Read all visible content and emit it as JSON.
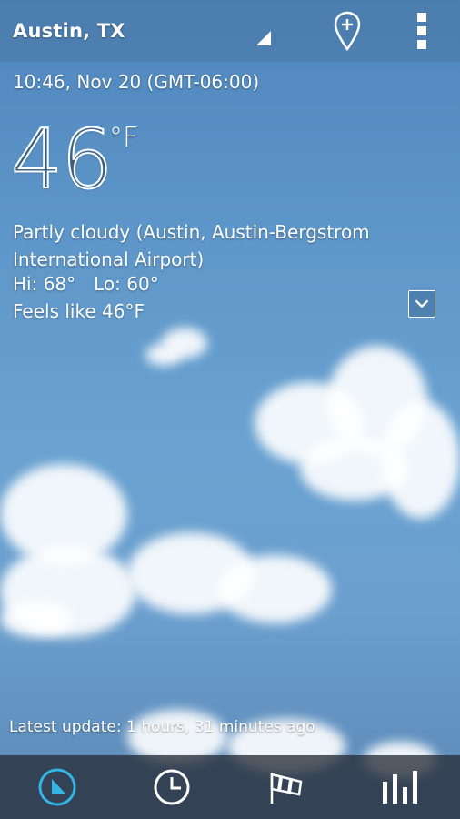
{
  "header": {
    "location": "Austin, TX"
  },
  "weather": {
    "datetime": "10:46, Nov 20 (GMT-06:00)",
    "temperature": "46",
    "unit": "°F",
    "condition": "Partly cloudy (Austin, Austin-Bergstrom International Airport)",
    "hi": "Hi: 68°",
    "lo": "Lo: 60°",
    "feels_like": "Feels like 46°F"
  },
  "footer": {
    "latest_update": "Latest update: 1 hours, 31 minutes ago"
  },
  "tabs": [
    {
      "name": "current-tab",
      "icon": "current-weather-icon",
      "active": true
    },
    {
      "name": "hourly-tab",
      "icon": "clock-icon",
      "active": false
    },
    {
      "name": "wind-tab",
      "icon": "windsock-icon",
      "active": false
    },
    {
      "name": "chart-tab",
      "icon": "bar-chart-icon",
      "active": false
    }
  ],
  "colors": {
    "accent": "#33b5e5",
    "bar_background": "#282e38",
    "sky": "#5e97c9"
  }
}
